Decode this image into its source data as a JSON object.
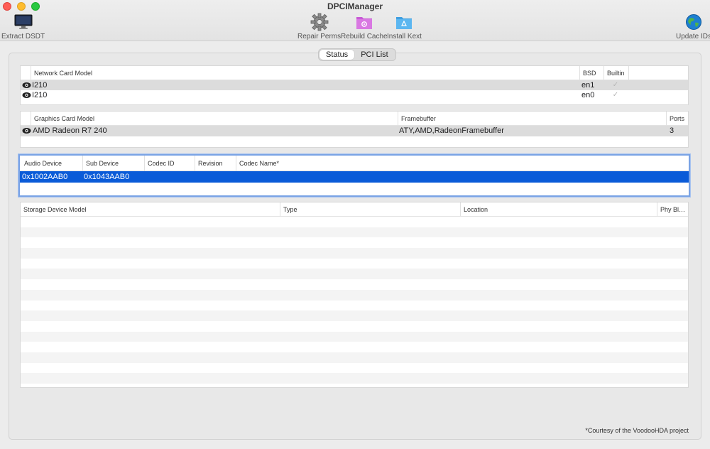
{
  "window": {
    "title": "DPCIManager"
  },
  "toolbar": {
    "extract": "Extract DSDT",
    "repair": "Repair Perms",
    "rebuild": "Rebuild Cache",
    "install": "Install Kext",
    "update": "Update IDs"
  },
  "tabs": {
    "status": "Status",
    "pci": "PCI List"
  },
  "network": {
    "headers": {
      "model": "Network Card Model",
      "bsd": "BSD",
      "builtin": "Builtin"
    },
    "rows": [
      {
        "model": "I210",
        "bsd": "en1",
        "builtin": "✓"
      },
      {
        "model": "I210",
        "bsd": "en0",
        "builtin": "✓"
      }
    ]
  },
  "graphics": {
    "headers": {
      "model": "Graphics Card Model",
      "framebuffer": "Framebuffer",
      "ports": "Ports"
    },
    "rows": [
      {
        "model": "AMD Radeon R7 240",
        "framebuffer": "ATY,AMD,RadeonFramebuffer",
        "ports": "3"
      }
    ]
  },
  "audio": {
    "headers": {
      "device": "Audio Device",
      "sub": "Sub Device",
      "codec_id": "Codec ID",
      "revision": "Revision",
      "codec_name": "Codec Name*"
    },
    "rows": [
      {
        "device": "0x1002AAB0",
        "sub": "0x1043AAB0",
        "codec_id": "",
        "revision": "",
        "codec_name": ""
      }
    ]
  },
  "storage": {
    "headers": {
      "model": "Storage Device Model",
      "type": "Type",
      "location": "Location",
      "phy": "Phy Bl…"
    }
  },
  "footer": {
    "courtesy": "*Courtesy of the VoodooHDA project"
  },
  "colors": {
    "selection_blue": "#0a5bd8",
    "focus_ring": "#7aa3e5"
  }
}
